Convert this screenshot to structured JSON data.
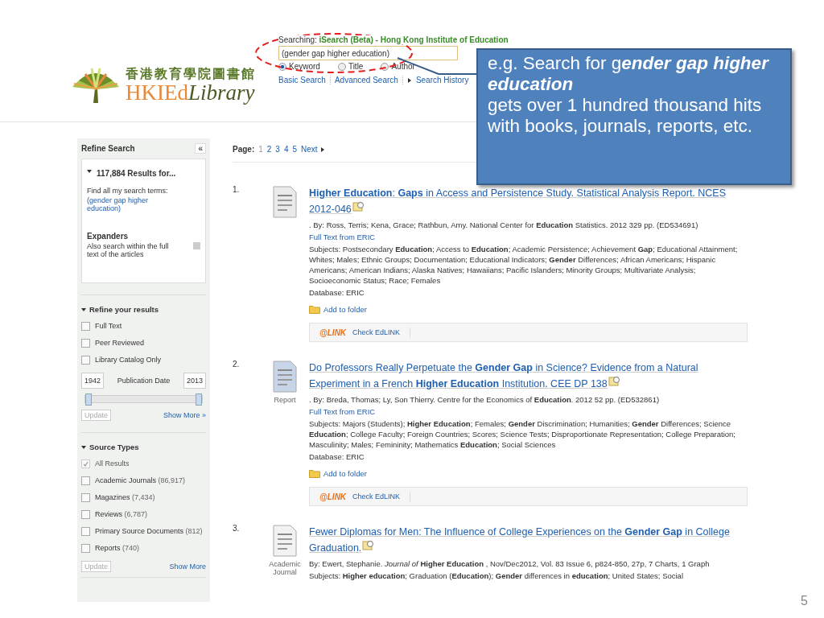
{
  "logo": {
    "chinese": "香港教育學院圖書館",
    "brand": "HKIEd",
    "library": "Library"
  },
  "search": {
    "searching_label": "Searching:",
    "searching_value": "iSearch (Beta) - Hong Kong Institute of Education",
    "query": "(gender gap higher education)",
    "options": [
      {
        "label": "Keyword",
        "selected": true
      },
      {
        "label": "Title",
        "selected": false
      },
      {
        "label": "Author",
        "selected": false
      }
    ],
    "links": [
      {
        "label": "Basic Search",
        "kind": "plain"
      },
      {
        "label": "Advanced Search",
        "kind": "plain"
      },
      {
        "label": "Search History",
        "kind": "arrow"
      }
    ]
  },
  "callout": {
    "lines": [
      "e.g. Search for g**ender gap higher education**",
      "gets over 1 hundred thousand hits with books, journals, reports, etc."
    ]
  },
  "sidebar": {
    "title": "Refine Search",
    "collapse": "«",
    "results_heading": "117,884 Results for...",
    "find_label": "Find all my search terms:",
    "find_query": "(gender gap higher education)",
    "expanders_title": "Expanders",
    "expander_label": "Also search within the full text of the articles",
    "expander_checked": false,
    "refine_title": "Refine your results",
    "refine_options": [
      {
        "label": "Full Text",
        "checked": false,
        "disabled": false
      },
      {
        "label": "Peer Reviewed",
        "checked": false,
        "disabled": false
      },
      {
        "label": "Library Catalog Only",
        "checked": false,
        "disabled": false
      }
    ],
    "date_slider": {
      "level": 1
    },
    "date_from": "1942",
    "date_label": "Publication Date",
    "date_to": "2013",
    "update": "Update",
    "show_more": "Show More »",
    "source_title": "Source Types",
    "source_options": [
      {
        "label": "All Results",
        "checked": true,
        "disabled": true
      },
      {
        "label": "Academic Journals",
        "count": "(86,917)",
        "checked": false,
        "disabled": false
      },
      {
        "label": "Magazines",
        "count": "(7,434)",
        "checked": false,
        "disabled": false
      },
      {
        "label": "Reviews",
        "count": "(6,787)",
        "checked": false,
        "disabled": false
      },
      {
        "label": "Primary Source Documents",
        "count": "(812)",
        "checked": false,
        "disabled": false
      },
      {
        "label": "Reports",
        "count": "(740)",
        "checked": false,
        "disabled": false
      }
    ],
    "source_update": "Update",
    "source_show_more": "Show More"
  },
  "pagination": {
    "label": "Page:",
    "pages": [
      {
        "label": "1",
        "selected": true
      },
      {
        "label": "2",
        "selected": false
      },
      {
        "label": "3",
        "selected": false
      },
      {
        "label": "4",
        "selected": false
      },
      {
        "label": "5",
        "selected": false
      }
    ],
    "next": "Next"
  },
  "results": [
    {
      "number": "1.",
      "kind": "document",
      "title": "**Higher Education**: **Gaps** in Access and Persistence Study. Statistical Analysis Report. NCES 2012-046",
      "meta": ". By: Ross, Terris; Kena, Grace; Rathbun, Amy. National Center for **Education** Statistics. 2012 329 pp. (ED534691)",
      "full_text": "Full Text from ERIC",
      "subjects": "Subjects: Postsecondary **Education**; Access to **Education**; Academic Persistence; Achievement **Gap**; Educational Attainment; Whites; Males; Ethnic Groups; Documentation; Educational Indicators; **Gender** Differences; African Americans; Hispanic Americans; American Indians; Alaska Natives; Hawaiians; Pacific Islanders; Minority Groups; Multivariate Analysis; Socioeconomic Status; Race; Females",
      "database": "Database: ERIC",
      "folder": "Add to folder",
      "edlink_logo": "@LINK",
      "edlink": "Check EdLINK"
    },
    {
      "number": "2.",
      "kind": "report",
      "type_label": "Report",
      "title": "Do Professors Really Perpetuate the **Gender Gap** in Science? Evidence from a Natural Experiment in a French **Higher Education** Institution. CEE DP 138",
      "meta": ". By: Breda, Thomas; Ly, Son Thierry. Centre for the Economics of **Education**. 2012 52 pp. (ED532861)",
      "full_text": "Full Text from ERIC",
      "subjects": "Subjects: Majors (Students); **Higher Education**; Females; **Gender** Discrimination; Humanities; **Gender** Differences; Science **Education**; College Faculty; Foreign Countries; Scores; Science Tests; Disproportionate Representation; College Preparation; Masculinity; Males; Femininity; Mathematics **Education**; Social Sciences",
      "database": "Database: ERIC",
      "folder": "Add to folder",
      "edlink_logo": "@LINK",
      "edlink": "Check EdLINK"
    },
    {
      "number": "3.",
      "kind": "journal",
      "type_label": "Academic Journal",
      "title": "Fewer Diplomas for Men: The Influence of College Experiences on the **Gender Gap** in College Graduation.",
      "meta": "By: Ewert, Stephanie. *Journal of* **Higher Education** , Nov/Dec2012, Vol. 83 Issue 6, p824-850, 27p, 7 Charts, 1 Graph",
      "subjects": "Subjects: **Higher education**; Graduation (**Education**); **Gender** differences in **education**; United States; Social"
    }
  ],
  "slide_number": "5"
}
